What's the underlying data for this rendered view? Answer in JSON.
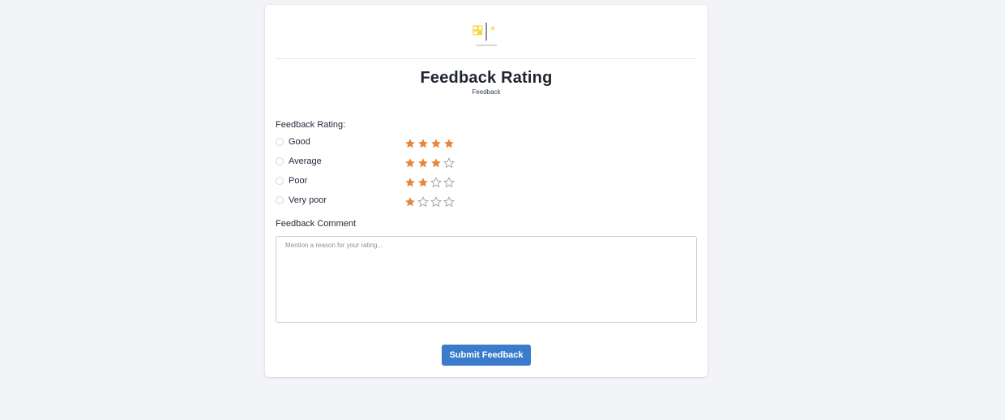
{
  "form": {
    "title": "Feedback Rating",
    "subtitle": "Feedback"
  },
  "rating": {
    "label": "Feedback Rating:",
    "max_stars": 4,
    "options": [
      {
        "label": "Good",
        "stars": 4,
        "selected": false
      },
      {
        "label": "Average",
        "stars": 3,
        "selected": false
      },
      {
        "label": "Poor",
        "stars": 2,
        "selected": false
      },
      {
        "label": "Very poor",
        "stars": 1,
        "selected": false
      }
    ]
  },
  "comment": {
    "label": "Feedback Comment",
    "placeholder": "Mention a reason for your rating...",
    "value": ""
  },
  "submit": {
    "label": "Submit Feedback"
  },
  "colors": {
    "page_background": "#f3f4f8",
    "star_filled": "#e8863d",
    "star_empty": "#9aa0a8",
    "button": "#3a7ccb",
    "logo_accent": "#f2d43a"
  },
  "icons": {
    "logo": "company-logo",
    "filled_star": "star-filled-icon",
    "empty_star": "star-outline-icon",
    "radio": "radio-button"
  }
}
